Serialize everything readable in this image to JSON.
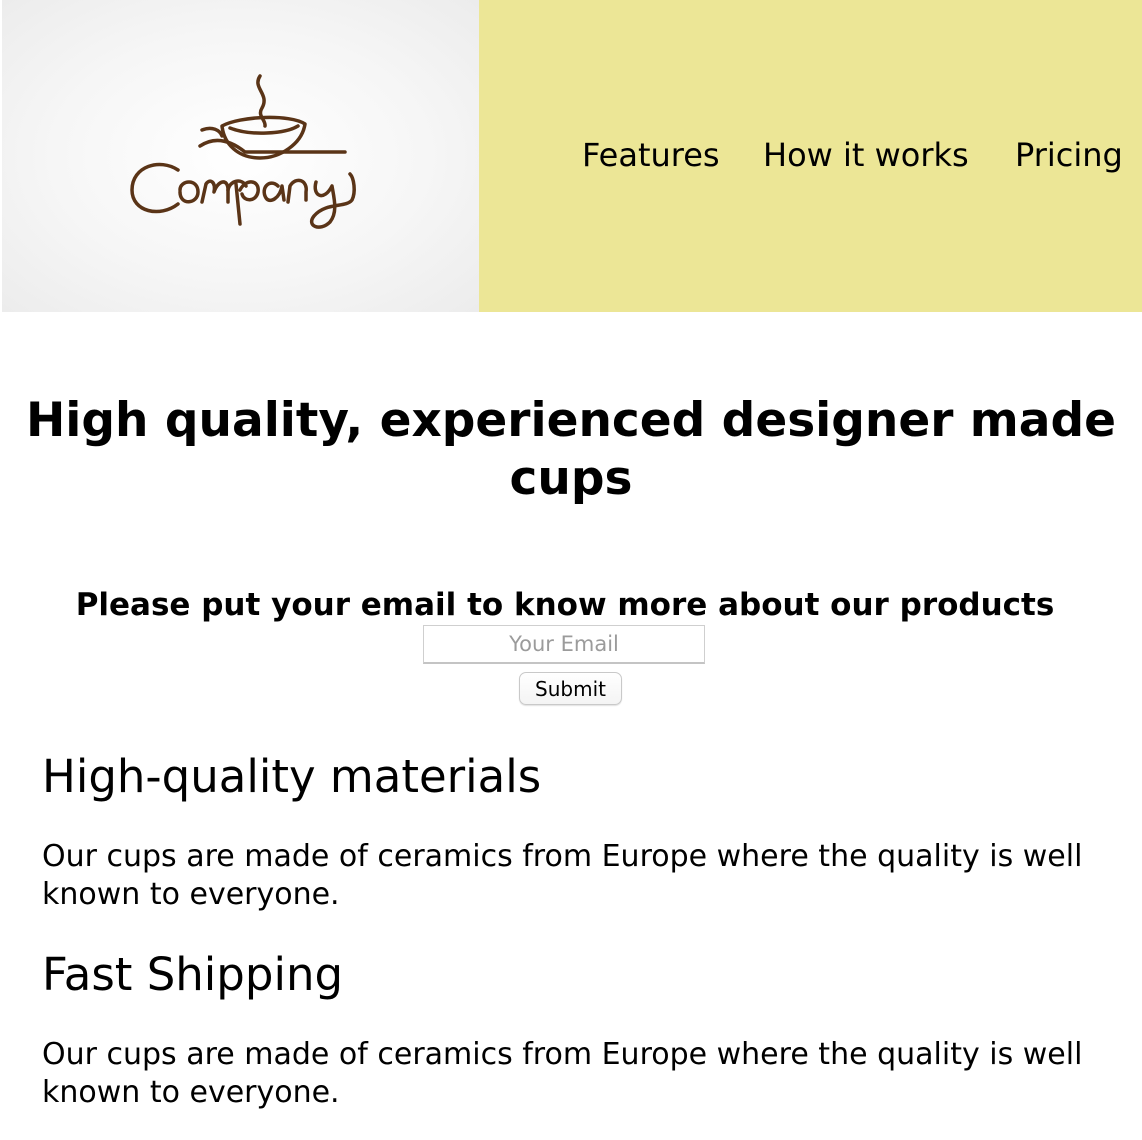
{
  "brand": {
    "logo_text": "Company",
    "logo_color": "#5a3417"
  },
  "header": {
    "nav_background": "#ece696",
    "nav": [
      {
        "label": "Features"
      },
      {
        "label": "How it works"
      },
      {
        "label": "Pricing"
      }
    ]
  },
  "hero": {
    "title": "High quality, experienced designer made cups"
  },
  "signup": {
    "heading": "Please put your email to know more about our products",
    "email_placeholder": "Your Email",
    "email_value": "",
    "submit_label": "Submit"
  },
  "features": [
    {
      "title": "High-quality materials",
      "text": "Our cups are made of ceramics from Europe where the quality is well known to everyone."
    },
    {
      "title": "Fast Shipping",
      "text": "Our cups are made of ceramics from Europe where the quality is well known to everyone."
    }
  ]
}
